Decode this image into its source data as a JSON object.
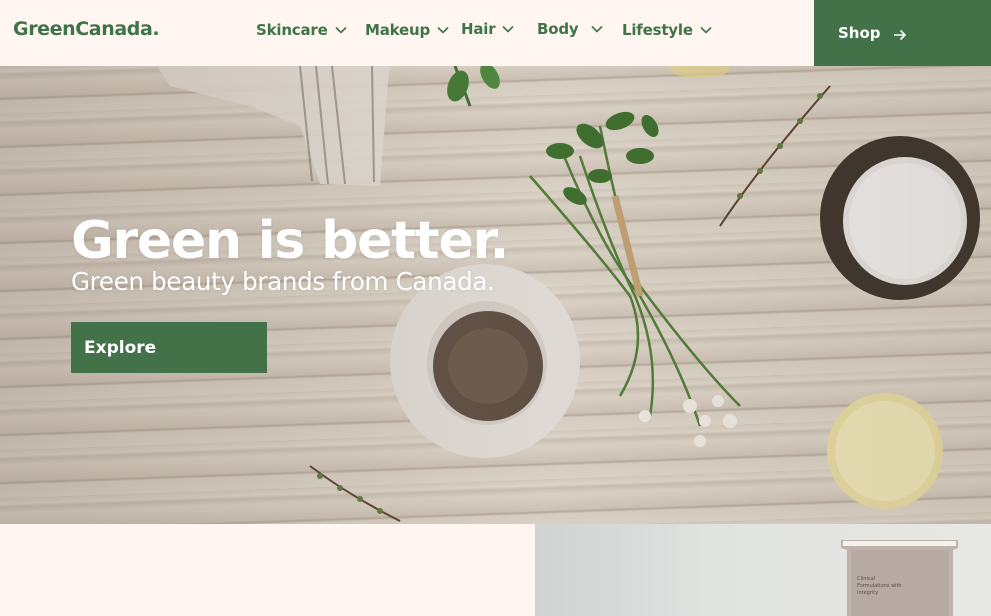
{
  "header": {
    "logo": "GreenCanada.",
    "nav": [
      {
        "label": "Skincare"
      },
      {
        "label": "Makeup"
      },
      {
        "label": "Hair"
      },
      {
        "label": "Body"
      },
      {
        "label": "Lifestyle"
      }
    ],
    "shop_label": "Shop"
  },
  "hero": {
    "title": "Green is better.",
    "subtitle": "Green beauty brands from Canada.",
    "cta_label": "Explore"
  },
  "promo": {
    "product_label": "Clinical Formulations with Integrity"
  },
  "colors": {
    "brand_green": "#437249",
    "background": "#fff6f1",
    "hero_text": "#ffffff"
  },
  "icons": {
    "nav_chevron": "chevron-down-icon",
    "shop_arrow": "arrow-right-icon"
  }
}
